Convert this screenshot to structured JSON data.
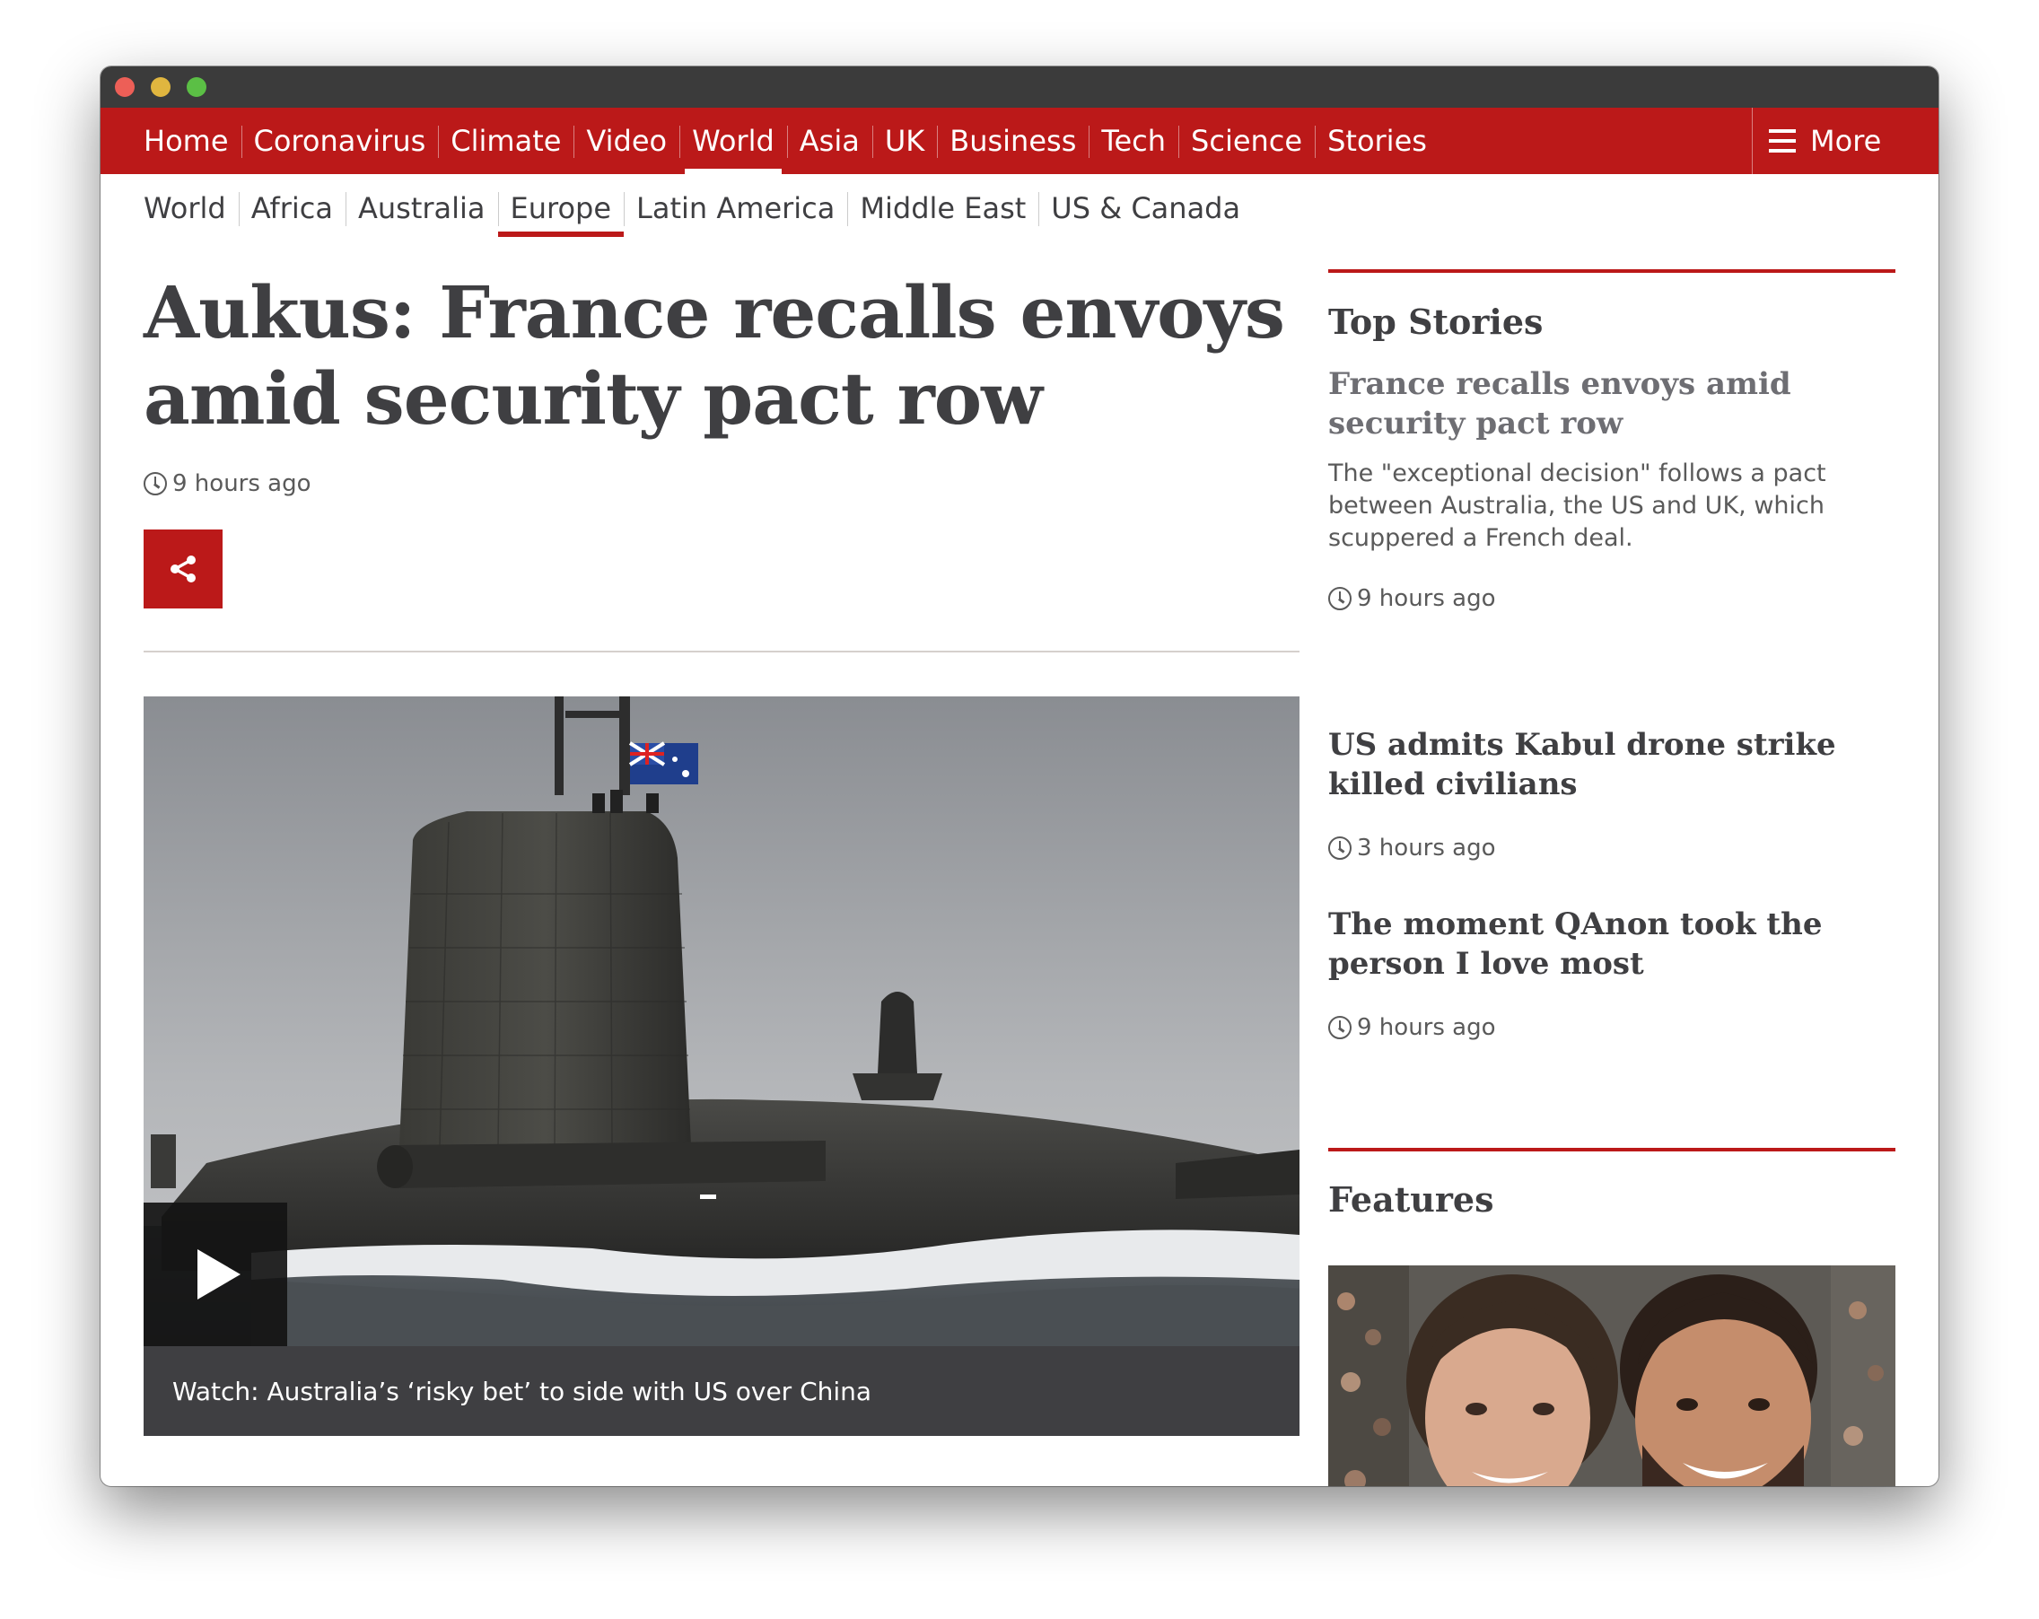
{
  "nav": {
    "items": [
      {
        "label": "Home"
      },
      {
        "label": "Coronavirus"
      },
      {
        "label": "Climate"
      },
      {
        "label": "Video"
      },
      {
        "label": "World",
        "active": true
      },
      {
        "label": "Asia"
      },
      {
        "label": "UK"
      },
      {
        "label": "Business"
      },
      {
        "label": "Tech"
      },
      {
        "label": "Science"
      },
      {
        "label": "Stories"
      }
    ],
    "more_label": "More"
  },
  "subnav": {
    "items": [
      {
        "label": "World"
      },
      {
        "label": "Africa"
      },
      {
        "label": "Australia"
      },
      {
        "label": "Europe",
        "active": true
      },
      {
        "label": "Latin America"
      },
      {
        "label": "Middle East"
      },
      {
        "label": "US & Canada"
      }
    ]
  },
  "article": {
    "headline": "Aukus: France recalls envoys amid security pact row",
    "timestamp": "9 hours ago",
    "video_caption": "Watch: Australia’s ‘risky bet’ to side with US over China"
  },
  "sidebar": {
    "top_stories_title": "Top Stories",
    "stories": [
      {
        "title": "France recalls envoys amid security pact row",
        "summary": "The \"exceptional decision\" follows a pact between Australia, the US and UK, which scuppered a French deal.",
        "timestamp": "9 hours ago"
      },
      {
        "title": "US admits Kabul drone strike killed civilians",
        "timestamp": "3 hours ago"
      },
      {
        "title": "The moment QAnon took the person I love most",
        "timestamp": "9 hours ago"
      }
    ],
    "features_title": "Features"
  },
  "colors": {
    "brand_red": "#bb1919",
    "text_dark": "#3f3f42",
    "caption_bg": "#3f3f42",
    "titlebar": "#3b3b3b"
  },
  "icons": {
    "share": "share-icon",
    "play": "play-icon",
    "clock": "clock-icon",
    "menu": "hamburger-menu-icon"
  }
}
